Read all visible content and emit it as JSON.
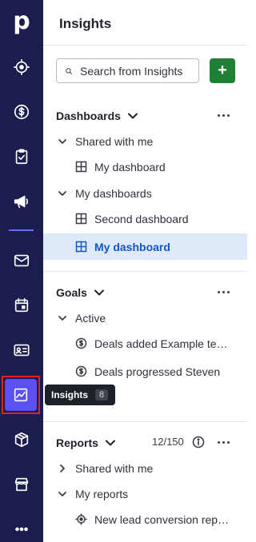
{
  "rail": {
    "logo": "p",
    "items": [
      {
        "name": "target-icon"
      },
      {
        "name": "dollar-icon"
      },
      {
        "name": "clipboard-check-icon"
      },
      {
        "name": "megaphone-icon"
      },
      {
        "name": "mail-icon"
      },
      {
        "name": "calendar-icon"
      },
      {
        "name": "contact-card-icon"
      },
      {
        "name": "chart-icon"
      },
      {
        "name": "box-icon"
      },
      {
        "name": "store-icon"
      },
      {
        "name": "more-icon"
      }
    ],
    "tooltip": {
      "label": "Insights",
      "count": "8"
    },
    "accent": "#5b50f2",
    "background": "#1b1d4e"
  },
  "panel": {
    "title": "Insights",
    "search_placeholder": "Search from Insights",
    "add_label": "+"
  },
  "dashboards": {
    "label": "Dashboards",
    "shared_label": "Shared with me",
    "shared_items": [
      "My dashboard"
    ],
    "mine_label": "My dashboards",
    "mine_items": [
      "Second dashboard",
      "My dashboard"
    ]
  },
  "goals": {
    "label": "Goals",
    "active_label": "Active",
    "items": [
      "Deals added Example team",
      "Deals progressed Steven"
    ]
  },
  "reports": {
    "label": "Reports",
    "count": "12/150",
    "shared_label": "Shared with me",
    "mine_label": "My reports",
    "items": [
      "New lead conversion report"
    ]
  },
  "colors": {
    "active_bg": "#deeaf9",
    "active_text": "#1456c4",
    "add_button": "#1f7f34"
  }
}
